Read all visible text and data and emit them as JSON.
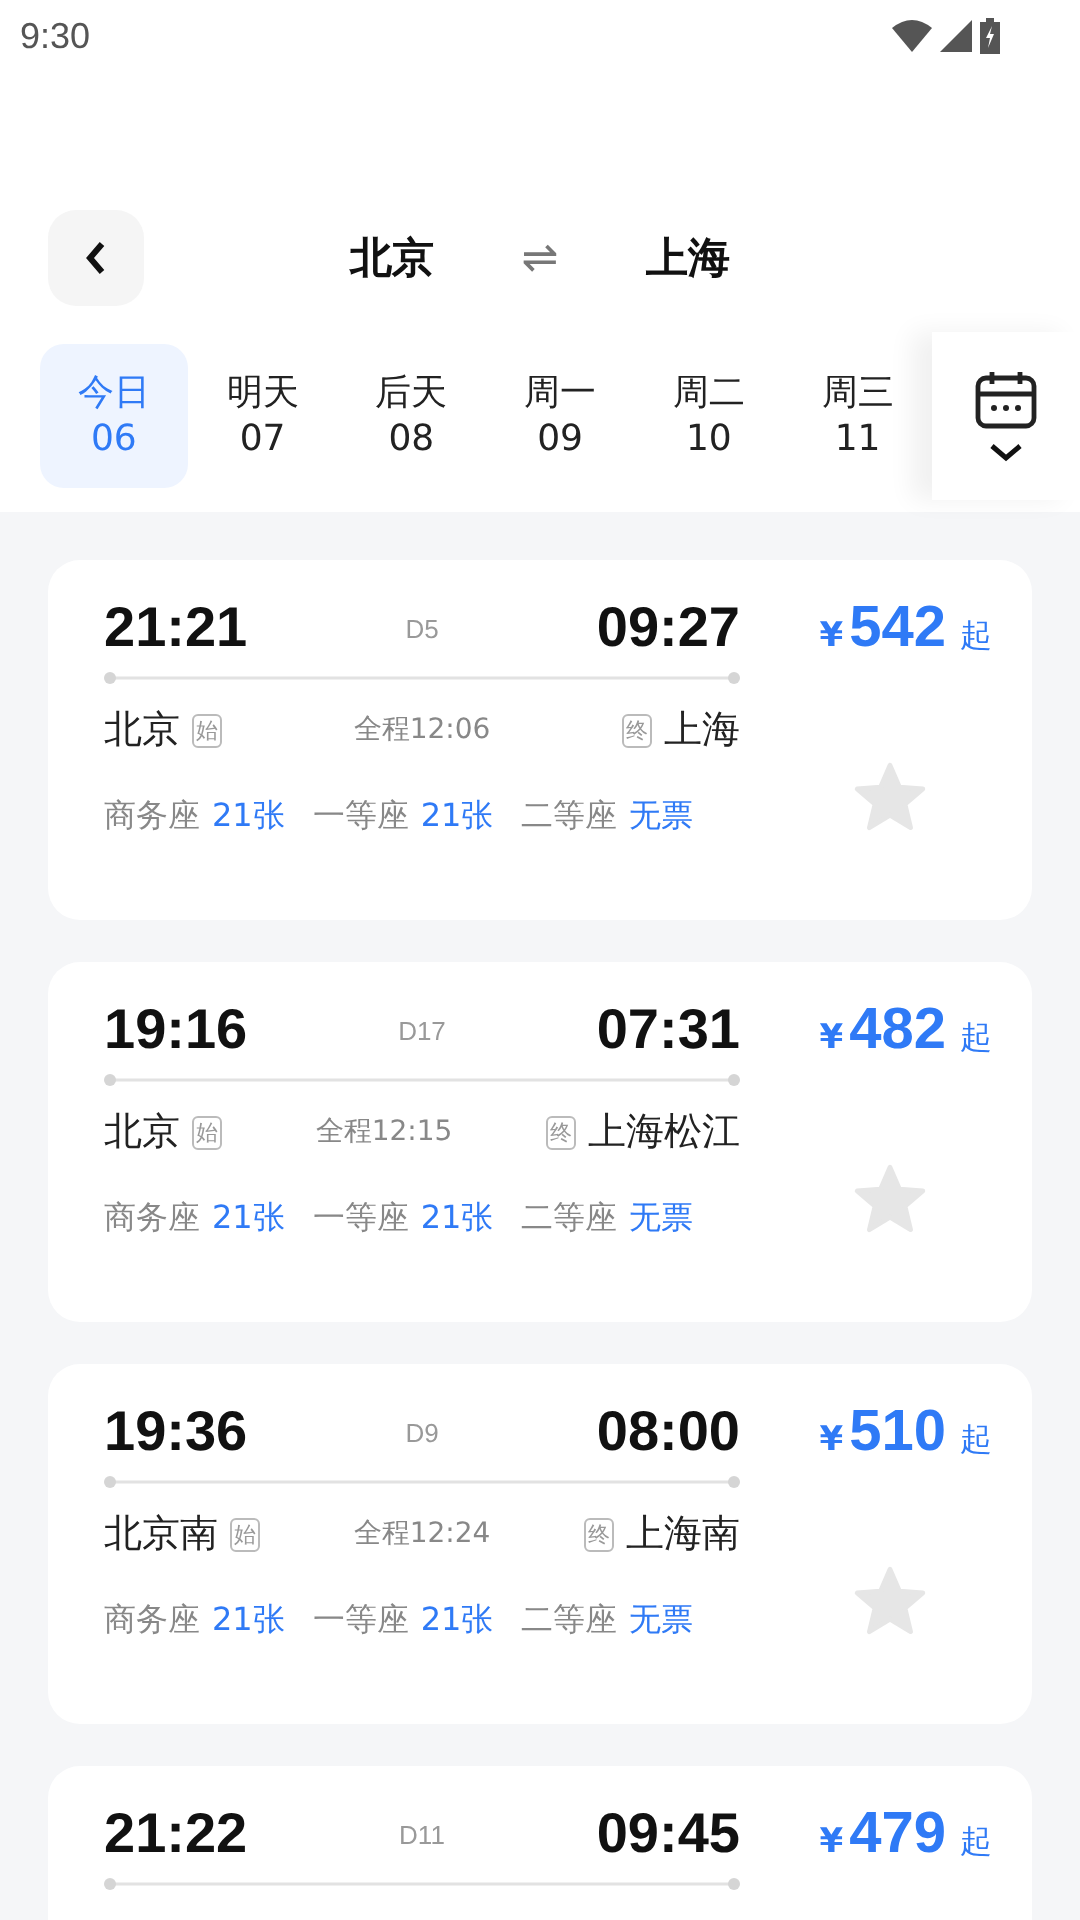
{
  "status_bar": {
    "time": "9:30"
  },
  "header": {
    "from": "北京",
    "swap": "⇌",
    "to": "上海"
  },
  "dates": [
    {
      "label": "今日",
      "day": "06",
      "selected": true
    },
    {
      "label": "明天",
      "day": "07",
      "selected": false
    },
    {
      "label": "后天",
      "day": "08",
      "selected": false
    },
    {
      "label": "周一",
      "day": "09",
      "selected": false
    },
    {
      "label": "周二",
      "day": "10",
      "selected": false
    },
    {
      "label": "周三",
      "day": "11",
      "selected": false
    }
  ],
  "trains": [
    {
      "depart": "21:21",
      "train": "D5",
      "arrive": "09:27",
      "price_symbol": "¥",
      "price": "542",
      "price_suffix": "起",
      "from": "北京",
      "from_tag": "始",
      "duration": "全程12:06",
      "to_tag": "终",
      "to": "上海",
      "seats": [
        {
          "class": "商务座",
          "count": "21张"
        },
        {
          "class": "一等座",
          "count": "21张"
        },
        {
          "class": "二等座",
          "count": "无票"
        }
      ]
    },
    {
      "depart": "19:16",
      "train": "D17",
      "arrive": "07:31",
      "price_symbol": "¥",
      "price": "482",
      "price_suffix": "起",
      "from": "北京",
      "from_tag": "始",
      "duration": "全程12:15",
      "to_tag": "终",
      "to": "上海松江",
      "seats": [
        {
          "class": "商务座",
          "count": "21张"
        },
        {
          "class": "一等座",
          "count": "21张"
        },
        {
          "class": "二等座",
          "count": "无票"
        }
      ]
    },
    {
      "depart": "19:36",
      "train": "D9",
      "arrive": "08:00",
      "price_symbol": "¥",
      "price": "510",
      "price_suffix": "起",
      "from": "北京南",
      "from_tag": "始",
      "duration": "全程12:24",
      "to_tag": "终",
      "to": "上海南",
      "seats": [
        {
          "class": "商务座",
          "count": "21张"
        },
        {
          "class": "一等座",
          "count": "21张"
        },
        {
          "class": "二等座",
          "count": "无票"
        }
      ]
    },
    {
      "depart": "21:22",
      "train": "D11",
      "arrive": "09:45",
      "price_symbol": "¥",
      "price": "479",
      "price_suffix": "起"
    }
  ]
}
